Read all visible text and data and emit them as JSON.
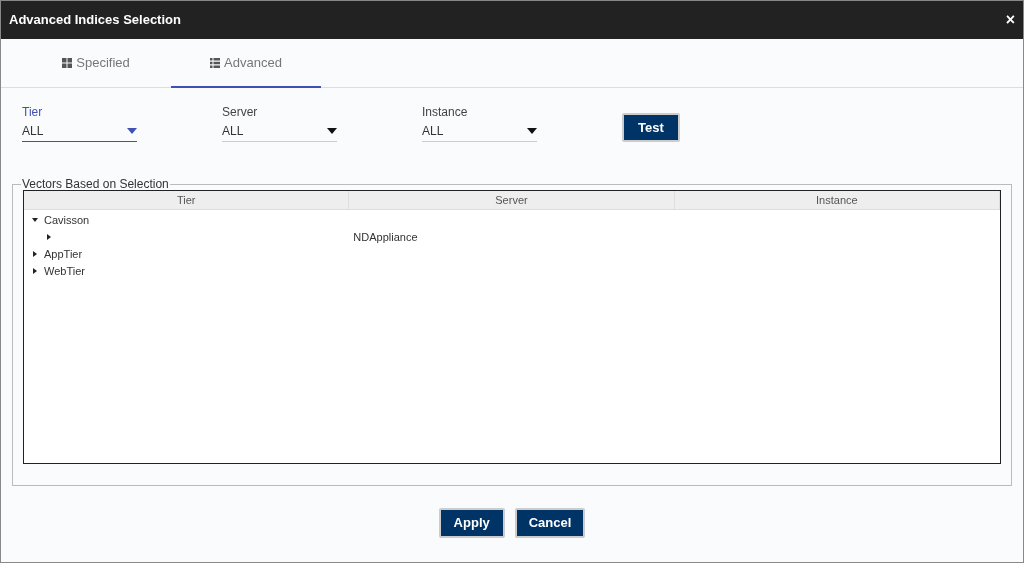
{
  "window": {
    "title": "Advanced Indices Selection",
    "close": "×"
  },
  "tabs": [
    {
      "label": "Specified",
      "kind": "grid",
      "selected": false
    },
    {
      "label": "Advanced",
      "kind": "list",
      "selected": true
    }
  ],
  "filters": [
    {
      "label": "Tier",
      "value": "ALL",
      "focused": true
    },
    {
      "label": "Server",
      "value": "ALL",
      "focused": false
    },
    {
      "label": "Instance",
      "value": "ALL",
      "focused": false
    }
  ],
  "test_button": "Test",
  "vectors": {
    "legend": "Vectors Based on Selection",
    "columns": [
      "Tier",
      "Server",
      "Instance"
    ],
    "rows": [
      {
        "tier": "Cavisson",
        "expanded": true,
        "children": [
          {
            "server": "NDAppliance",
            "expanded": false
          }
        ]
      },
      {
        "tier": "AppTier",
        "expanded": false
      },
      {
        "tier": "WebTier",
        "expanded": false
      }
    ]
  },
  "buttons": [
    "Apply",
    "Cancel"
  ]
}
